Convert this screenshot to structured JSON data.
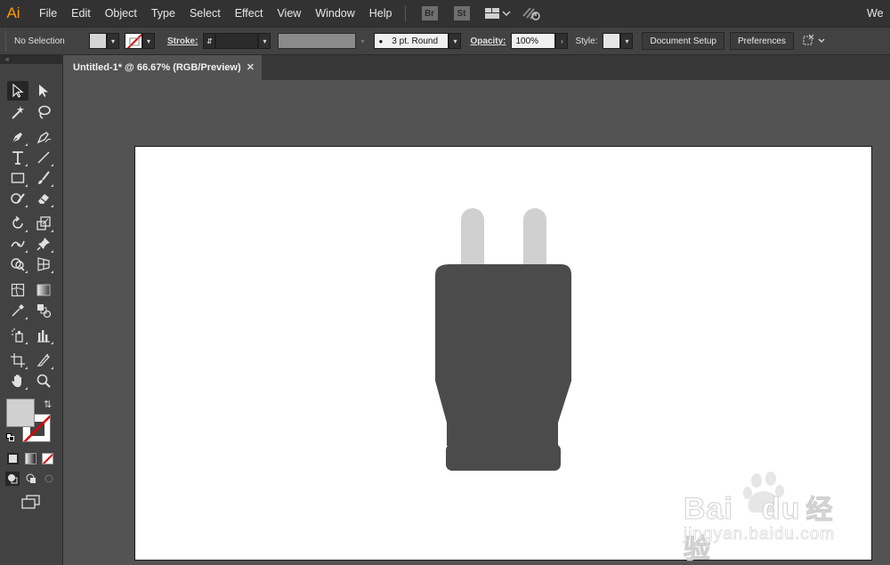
{
  "app": {
    "logo": "Ai",
    "workspace": "We"
  },
  "menu": [
    "File",
    "Edit",
    "Object",
    "Type",
    "Select",
    "Effect",
    "View",
    "Window",
    "Help"
  ],
  "badges": {
    "bridge": "Br",
    "stock": "St"
  },
  "control": {
    "selection": "No Selection",
    "stroke_label": "Stroke:",
    "brush": "3 pt. Round",
    "opacity_label": "Opacity:",
    "opacity_value": "100%",
    "style_label": "Style:",
    "document_setup": "Document Setup",
    "preferences": "Preferences",
    "fill_color": "#d4d4d4",
    "style_color": "#e6e6e6"
  },
  "document": {
    "tab_title": "Untitled-1* @ 66.67% (RGB/Preview)",
    "close_glyph": "✕"
  },
  "tools_panel": {
    "collapse_glyph": "«",
    "fill_color": "#d0d0d0",
    "stroke_color": "none"
  },
  "artwork": {
    "plug_body_color": "#4b4b4b",
    "prong_color": "#d0d0d0"
  },
  "watermark": {
    "brand": "Bai",
    "brand2": "du",
    "cn": "经验",
    "url": "jingyan.baidu.com"
  }
}
